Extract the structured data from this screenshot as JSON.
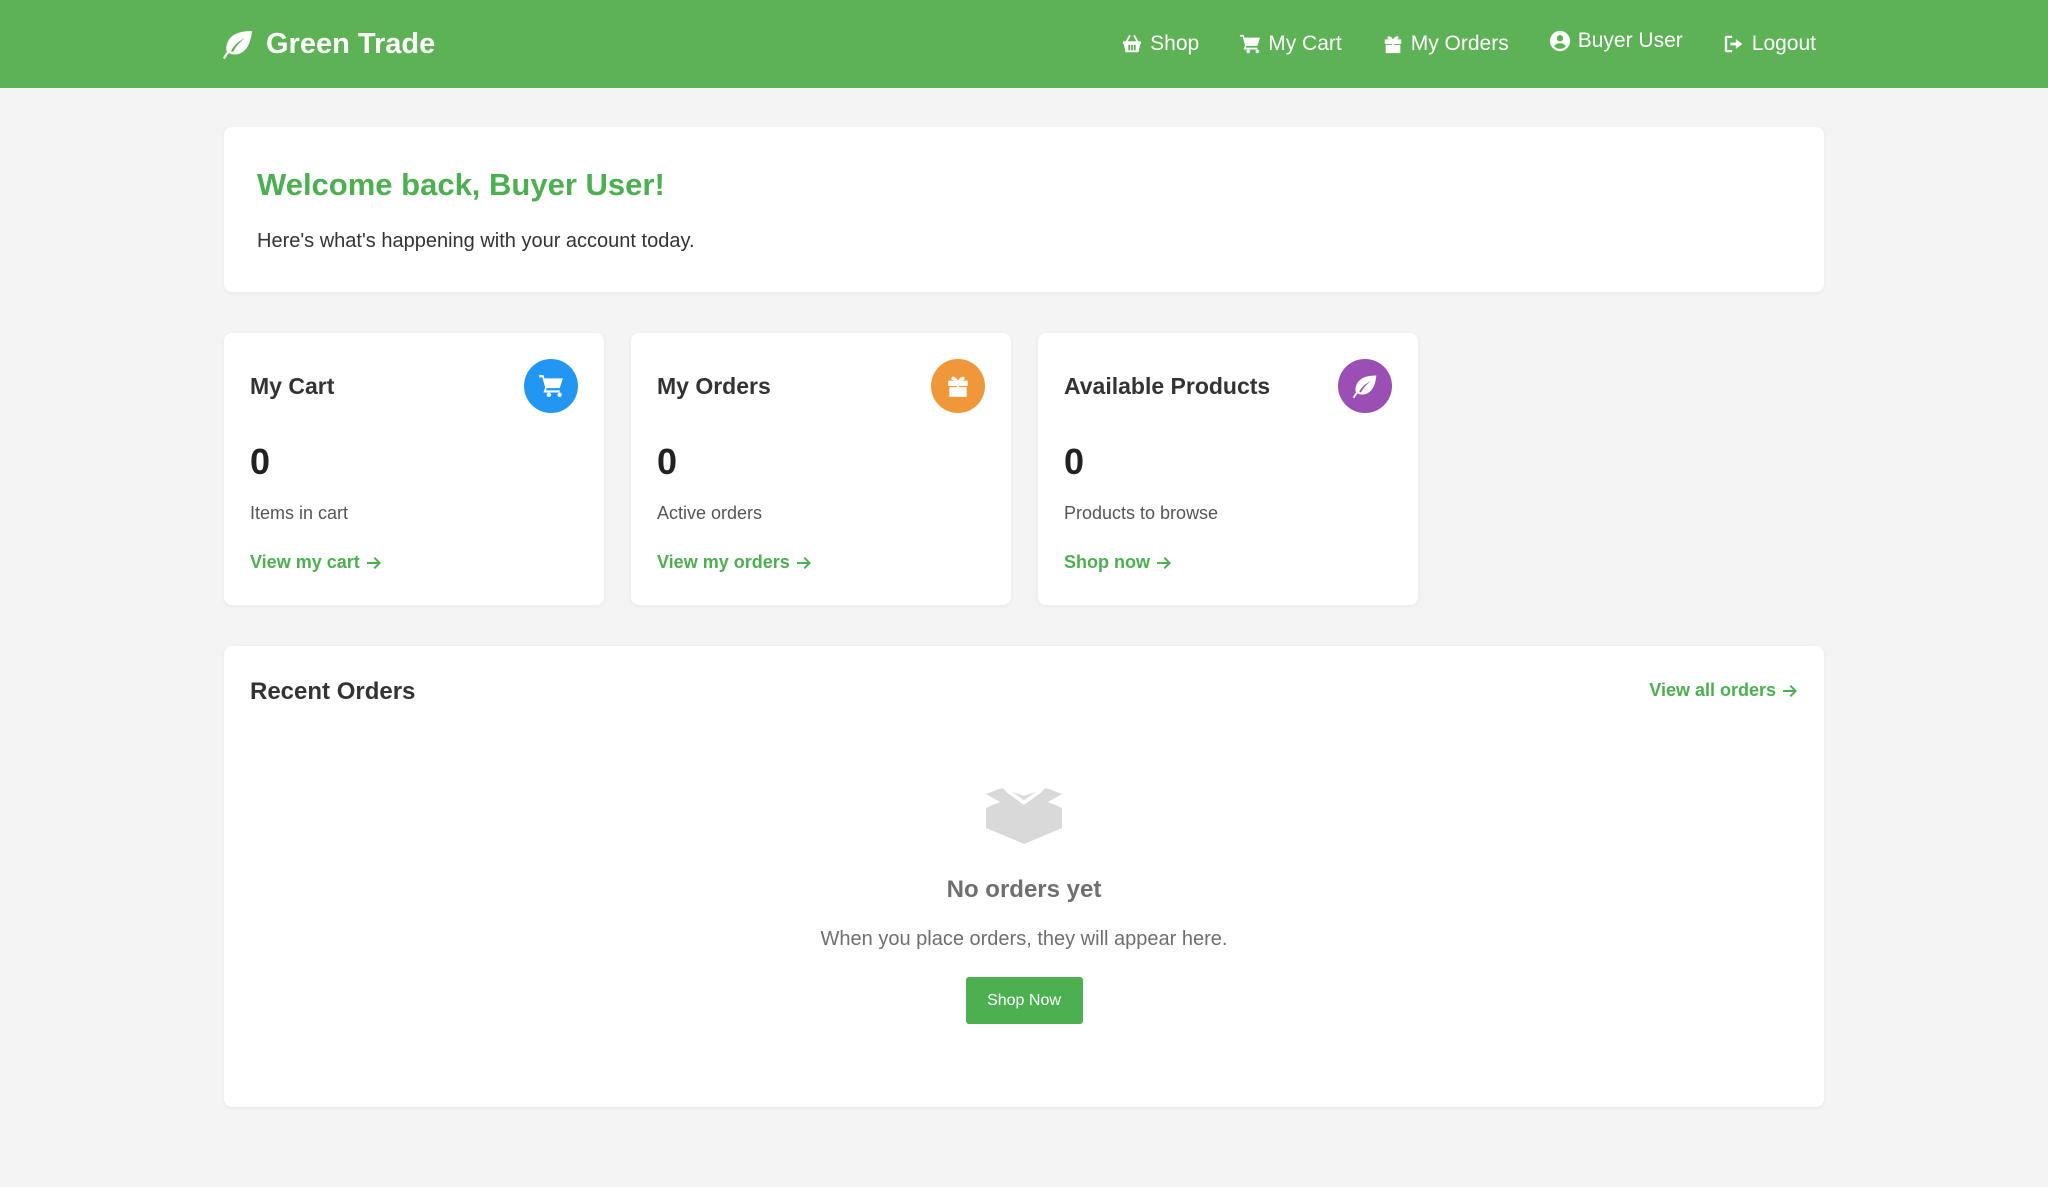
{
  "brand": {
    "name": "Green Trade",
    "icon": "leaf-icon"
  },
  "nav": {
    "shop": "Shop",
    "cart": "My Cart",
    "orders": "My Orders",
    "user": "Buyer User",
    "logout": "Logout"
  },
  "welcome": {
    "title": "Welcome back, Buyer User!",
    "subtitle": "Here's what's happening with your account today."
  },
  "stats": [
    {
      "title": "My Cart",
      "value": "0",
      "desc": "Items in cart",
      "link": "View my cart",
      "icon": "cart-icon",
      "color": "#2196f3"
    },
    {
      "title": "My Orders",
      "value": "0",
      "desc": "Active orders",
      "link": "View my orders",
      "icon": "gift-icon",
      "color": "#f0973a"
    },
    {
      "title": "Available Products",
      "value": "0",
      "desc": "Products to browse",
      "link": "Shop now",
      "icon": "leaf-icon",
      "color": "#9b4fb5"
    }
  ],
  "recent": {
    "title": "Recent Orders",
    "view_all": "View all orders",
    "empty_title": "No orders yet",
    "empty_text": "When you place orders, they will appear here.",
    "button": "Shop Now"
  },
  "colors": {
    "navbar": "#5cb254",
    "accent": "#4caf50",
    "background": "#f4f4f4"
  }
}
